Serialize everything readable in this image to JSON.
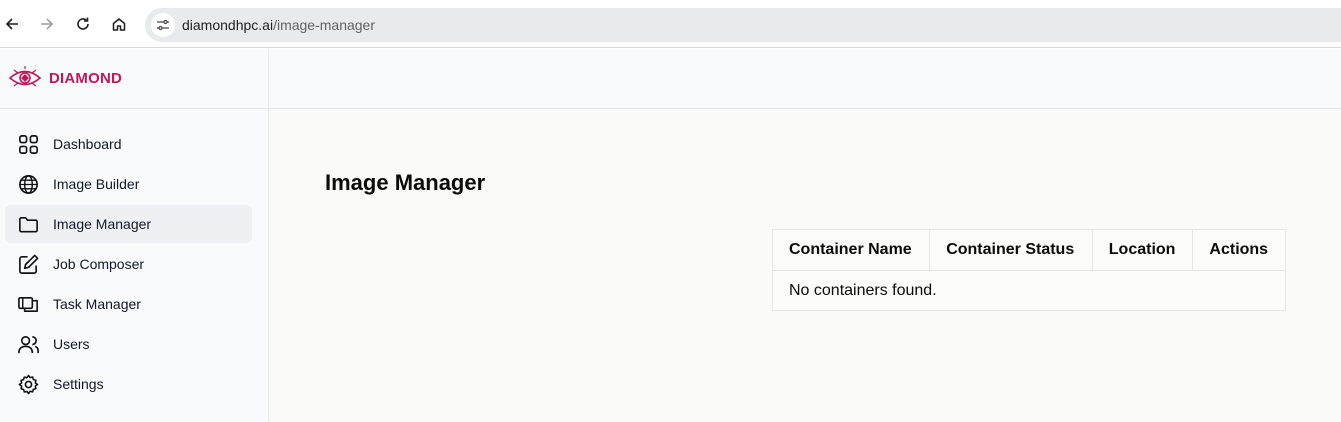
{
  "browser": {
    "url_host": "diamondhpc.ai",
    "url_path": "/image-manager",
    "back_icon": "arrow-left-icon",
    "forward_icon": "arrow-right-icon",
    "reload_icon": "reload-icon",
    "home_icon": "home-icon",
    "site_info_icon": "tune-icon"
  },
  "brand": {
    "name": "DIAMOND",
    "logo_icon": "diamond-eye-logo",
    "color": "#c2185b"
  },
  "sidebar": {
    "items": [
      {
        "label": "Dashboard",
        "icon": "grid-icon",
        "active": false
      },
      {
        "label": "Image Builder",
        "icon": "globe-icon",
        "active": false
      },
      {
        "label": "Image Manager",
        "icon": "folder-icon",
        "active": true
      },
      {
        "label": "Job Composer",
        "icon": "edit-icon",
        "active": false
      },
      {
        "label": "Task Manager",
        "icon": "windows-icon",
        "active": false
      },
      {
        "label": "Users",
        "icon": "users-icon",
        "active": false
      },
      {
        "label": "Settings",
        "icon": "gear-icon",
        "active": false
      }
    ]
  },
  "main": {
    "title": "Image Manager",
    "table": {
      "headers": [
        "Container Name",
        "Container Status",
        "Location",
        "Actions"
      ],
      "empty_message": "No containers found."
    }
  }
}
